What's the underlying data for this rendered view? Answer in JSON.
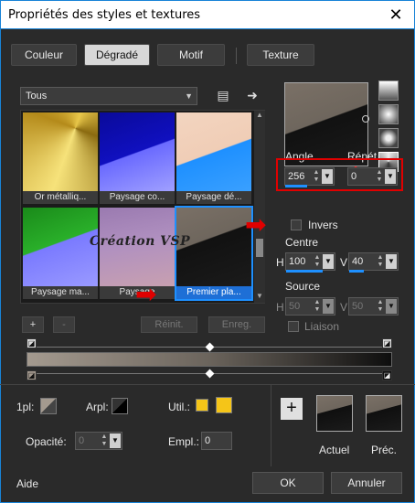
{
  "window": {
    "title": "Propriétés des styles et textures",
    "close_glyph": "✕"
  },
  "tabs": [
    {
      "label": "Couleur"
    },
    {
      "label": "Dégradé"
    },
    {
      "label": "Motif"
    },
    {
      "label": "Texture"
    }
  ],
  "category_select": {
    "value": "Tous"
  },
  "thumbnails": [
    {
      "label": "Or métalliq..."
    },
    {
      "label": "Paysage co..."
    },
    {
      "label": "Paysage dé..."
    },
    {
      "label": "Paysage ma..."
    },
    {
      "label": "Paysage"
    },
    {
      "label": "Premier pla..."
    }
  ],
  "watermark_text": "Création VSP",
  "list_buttons": {
    "add": "+",
    "remove": "-",
    "reset": "Réinit.",
    "save": "Enreg."
  },
  "angle": {
    "label": "Angle",
    "value": "256"
  },
  "repeat": {
    "label": "Répét.",
    "value": "0"
  },
  "invert": {
    "label": "Invers"
  },
  "centre": {
    "label": "Centre",
    "h_label": "H",
    "h_value": "100",
    "v_label": "V",
    "v_value": "40"
  },
  "source": {
    "label": "Source",
    "h_label": "H",
    "h_value": "50",
    "v_label": "V",
    "v_value": "50"
  },
  "link": {
    "label": "Liaison"
  },
  "bottom": {
    "first_plane_label": "1pl:",
    "arrplan_label": "Arpl:",
    "util_label": "Util.:",
    "opacity_label": "Opacité:",
    "opacity_value": "0",
    "empl_label": "Empl.:",
    "empl_value": "0",
    "add_glyph": "+",
    "current_label": "Actuel",
    "previous_label": "Préc."
  },
  "footer": {
    "help": "Aide",
    "ok": "OK",
    "cancel": "Annuler"
  },
  "colors": {
    "accent": "#1e90ff",
    "swatch_yellow": "#f5c518",
    "annotation_red": "#e00000"
  }
}
